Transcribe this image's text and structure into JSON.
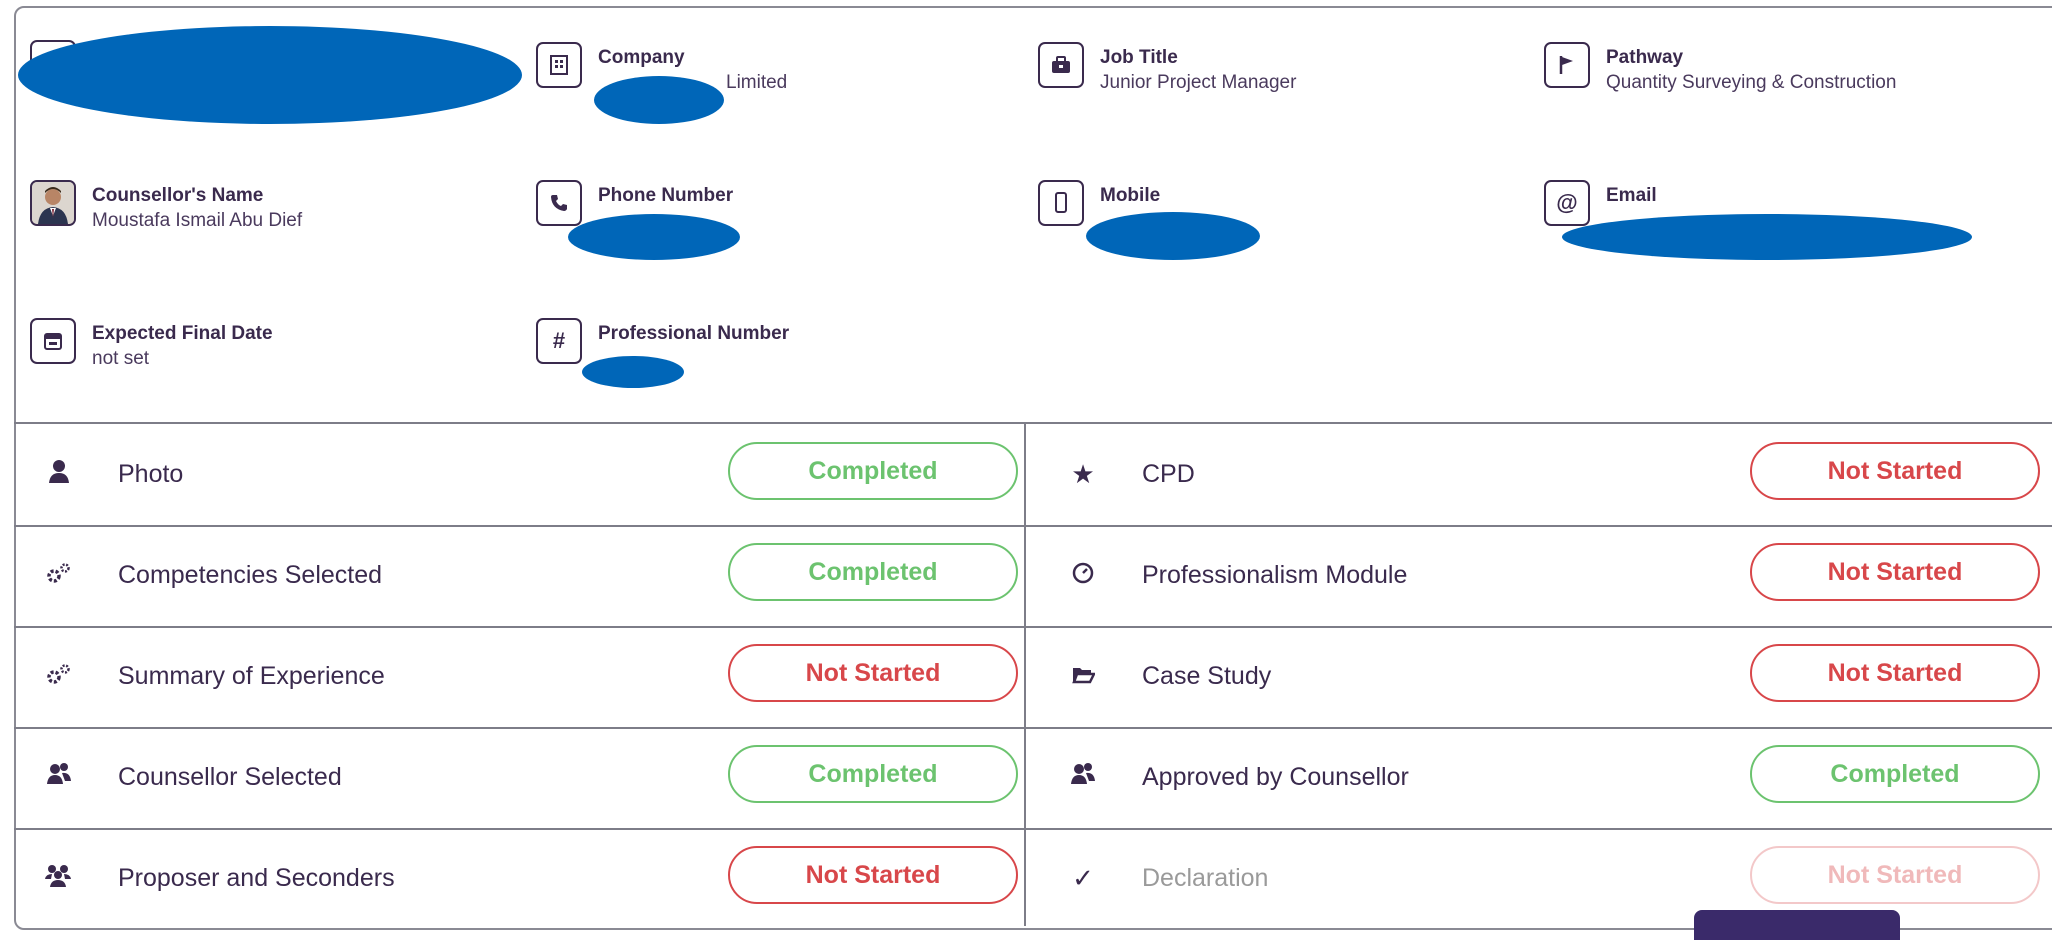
{
  "profile": {
    "company": {
      "label": "Company",
      "value": "Limited"
    },
    "job_title": {
      "label": "Job Title",
      "value": "Junior Project Manager"
    },
    "pathway": {
      "label": "Pathway",
      "value": "Quantity Surveying & Construction"
    },
    "counsellor": {
      "label": "Counsellor's Name",
      "value": "Moustafa Ismail Abu Dief"
    },
    "phone": {
      "label": "Phone Number",
      "value": ""
    },
    "mobile": {
      "label": "Mobile",
      "value": ""
    },
    "email": {
      "label": "Email",
      "value": ""
    },
    "expected_final_date": {
      "label": "Expected Final Date",
      "value": "not set"
    },
    "professional_number": {
      "label": "Professional Number",
      "value": ""
    }
  },
  "status_rows": [
    {
      "left": {
        "icon": "person-icon",
        "label": "Photo",
        "status": "Completed"
      },
      "right": {
        "icon": "star-icon",
        "label": "CPD",
        "status": "Not Started"
      }
    },
    {
      "left": {
        "icon": "gears-icon",
        "label": "Competencies Selected",
        "status": "Completed"
      },
      "right": {
        "icon": "clock-icon",
        "label": "Professionalism Module",
        "status": "Not Started"
      }
    },
    {
      "left": {
        "icon": "gears-icon",
        "label": "Summary of Experience",
        "status": "Not Started"
      },
      "right": {
        "icon": "folder-icon",
        "label": "Case Study",
        "status": "Not Started"
      }
    },
    {
      "left": {
        "icon": "users-icon",
        "label": "Counsellor Selected",
        "status": "Completed"
      },
      "right": {
        "icon": "users-icon",
        "label": "Approved by Counsellor",
        "status": "Completed"
      }
    },
    {
      "left": {
        "icon": "group-icon",
        "label": "Proposer and Seconders",
        "status": "Not Started"
      },
      "right": {
        "icon": "checkmark-icon",
        "label": "Declaration",
        "status": "Not Started"
      }
    }
  ],
  "colors": {
    "completed": "#6cc36f",
    "not_started": "#d8474a",
    "text": "#3a2a4d",
    "redaction": "#0066b8"
  }
}
